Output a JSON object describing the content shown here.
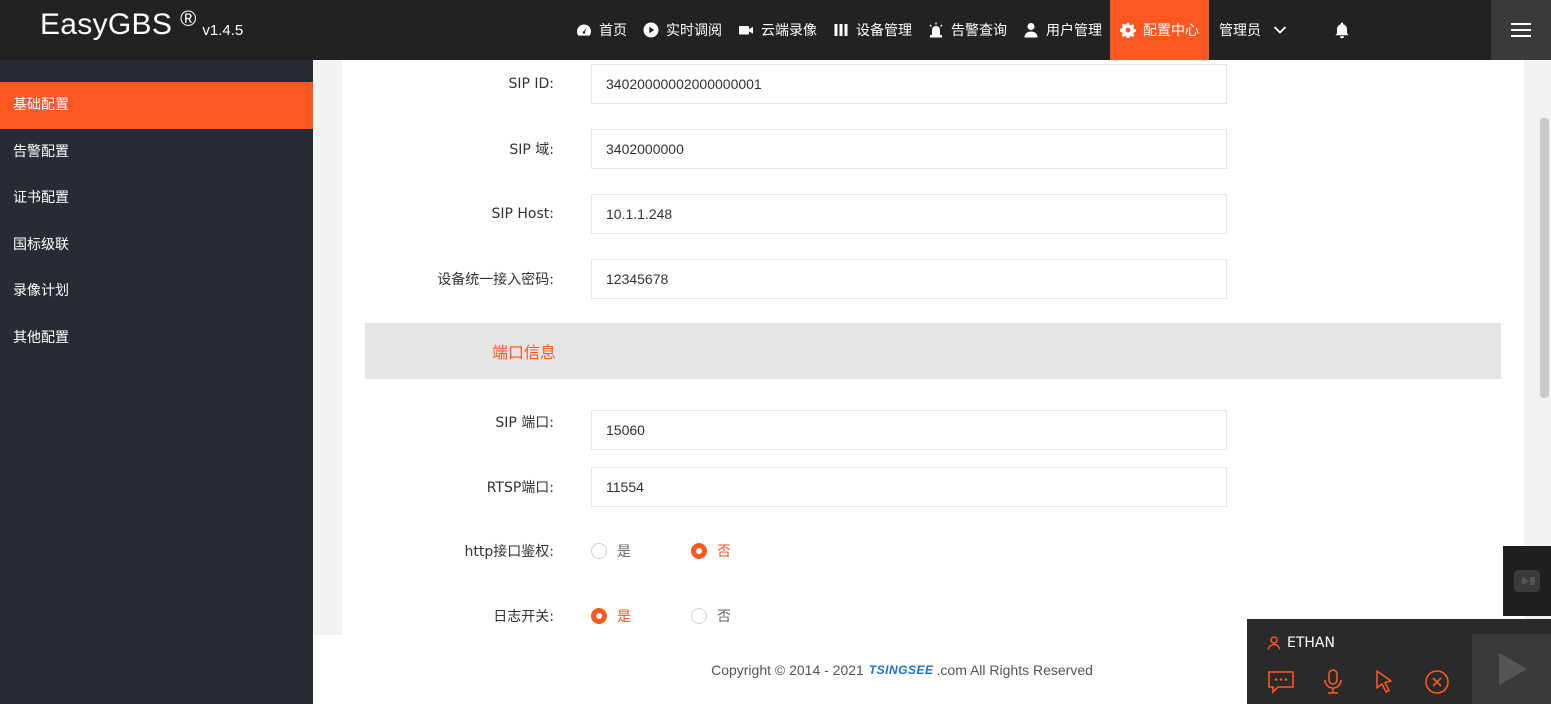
{
  "app": {
    "name": "EasyGBS",
    "registered": "®",
    "version": "v1.4.5"
  },
  "nav": {
    "items": [
      {
        "label": "首页",
        "icon": "dashboard-icon"
      },
      {
        "label": "实时调阅",
        "icon": "play-circle-icon"
      },
      {
        "label": "云端录像",
        "icon": "video-camera-icon"
      },
      {
        "label": "设备管理",
        "icon": "devices-icon"
      },
      {
        "label": "告警查询",
        "icon": "alarm-light-icon"
      },
      {
        "label": "用户管理",
        "icon": "user-icon"
      },
      {
        "label": "配置中心",
        "icon": "gear-icon",
        "active": true
      }
    ],
    "user": "管理员",
    "accent_color": "#ff5722"
  },
  "sidebar": {
    "items": [
      {
        "label": "基础配置",
        "active": true
      },
      {
        "label": "告警配置"
      },
      {
        "label": "证书配置"
      },
      {
        "label": "国标级联"
      },
      {
        "label": "录像计划"
      },
      {
        "label": "其他配置"
      }
    ]
  },
  "form": {
    "sip_id": {
      "label": "SIP ID:",
      "value": "34020000002000000001"
    },
    "sip_domain": {
      "label": "SIP 域:",
      "value": "3402000000"
    },
    "sip_host": {
      "label": "SIP Host:",
      "value": "10.1.1.248"
    },
    "device_password": {
      "label": "设备统一接入密码:",
      "value": "12345678"
    },
    "port_section": {
      "title": "端口信息"
    },
    "sip_port": {
      "label": "SIP 端口:",
      "value": "15060"
    },
    "rtsp_port": {
      "label": "RTSP端口:",
      "value": "11554"
    },
    "http_auth": {
      "label": "http接口鉴权:",
      "options": [
        "是",
        "否"
      ],
      "selected": "否"
    },
    "log_switch": {
      "label": "日志开关:",
      "options": [
        "是",
        "否"
      ],
      "selected": "是"
    }
  },
  "footer": {
    "prefix": "Copyright © 2014 - 2021",
    "brand": "TSINGSEE",
    "suffix": ".com All Rights Reserved"
  },
  "call_widget": {
    "user": "ETHAN"
  }
}
